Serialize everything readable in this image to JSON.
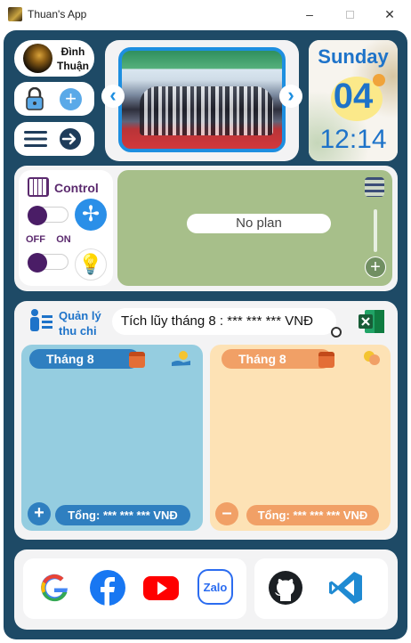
{
  "window": {
    "title": "Thuan's App",
    "minimize": "–",
    "close": "✕"
  },
  "user": {
    "name_line1": "Đình",
    "name_line2": "Thuận"
  },
  "date": {
    "day_name": "Sunday",
    "day_number": "04",
    "time": "12:14"
  },
  "control": {
    "title": "Control",
    "off_label": "OFF",
    "on_label": "ON"
  },
  "plan": {
    "empty_text": "No plan"
  },
  "finance": {
    "title_line1": "Quản lý",
    "title_line2": "thu chi",
    "accumulated": "Tích lũy tháng 8 : *** *** *** VNĐ",
    "income": {
      "month": "Tháng 8",
      "total": "Tổng: *** *** *** VNĐ",
      "button": "+"
    },
    "expense": {
      "month": "Tháng 8",
      "total": "Tổng: *** *** *** VNĐ",
      "button": "–"
    }
  },
  "links": {
    "zalo_label": "Zalo"
  },
  "colors": {
    "frame": "#1e4a66",
    "accent_blue": "#1e73c9",
    "income": "#95cde0",
    "expense": "#fde2b5",
    "plan": "#a7bf8a"
  }
}
